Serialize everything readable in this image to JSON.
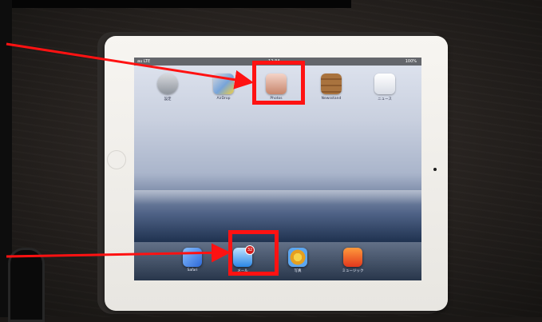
{
  "scene": {
    "description": "Photograph of an iPad home screen with two highlighted app icons"
  },
  "status_bar": {
    "carrier": "au LTE",
    "time": "12:34",
    "battery": "100%"
  },
  "home_apps": [
    {
      "label": "設定",
      "icon": "settings-icon"
    },
    {
      "label": "AirDrop",
      "icon": "airdrop-icon"
    },
    {
      "label": "Photos",
      "icon": "photos-icon"
    },
    {
      "label": "Newsstand",
      "icon": "newsstand-icon"
    },
    {
      "label": "ニュース",
      "icon": "news-icon"
    }
  ],
  "dock_apps": [
    {
      "label": "Safari",
      "icon": "safari-icon"
    },
    {
      "label": "メール",
      "icon": "mail-icon",
      "badge": "32"
    },
    {
      "label": "写真",
      "icon": "photos-icon"
    },
    {
      "label": "ミュージック",
      "icon": "music-icon"
    }
  ],
  "colors": {
    "annotation": "#ff1212"
  }
}
